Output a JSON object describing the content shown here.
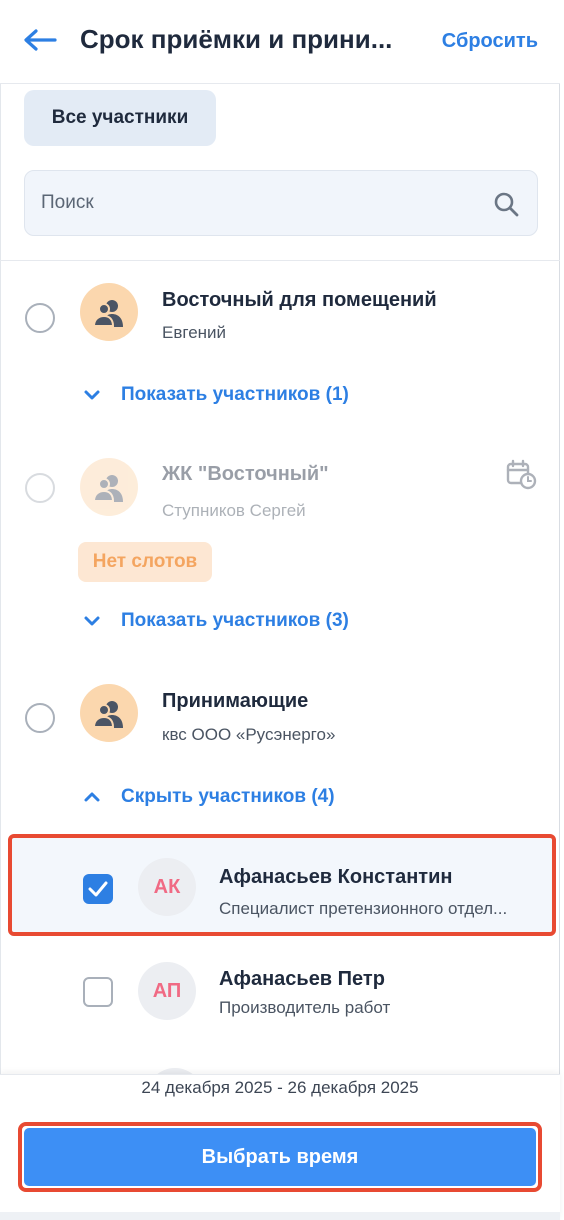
{
  "header": {
    "title": "Срок приёмки и прини...",
    "reset_label": "Сбросить"
  },
  "filter": {
    "chip_label": "Все участники"
  },
  "search": {
    "placeholder": "Поиск"
  },
  "groups": [
    {
      "title": "Восточный для помещений",
      "subtitle": "Евгений",
      "toggle_label": "Показать участников (1)"
    },
    {
      "title": "ЖК \"Восточный\"",
      "subtitle": "Ступников Сергей",
      "badge": "Нет слотов",
      "toggle_label": "Показать участников (3)"
    },
    {
      "title": "Принимающие",
      "subtitle": "квс ООО «Русэнерго»",
      "toggle_label": "Скрыть участников (4)"
    }
  ],
  "members": [
    {
      "initials": "АК",
      "name": "Афанасьев Константин",
      "role": "Специалист претензионного отдел...",
      "checked": true
    },
    {
      "initials": "АП",
      "name": "Афанасьев Петр",
      "role": "Производитель работ",
      "checked": false
    }
  ],
  "footer": {
    "date_range": "24 декабря 2025 - 26 декабря 2025",
    "cta_label": "Выбрать время"
  },
  "colors": {
    "accent": "#2d7fe3",
    "cta": "#3d8ff5",
    "highlight": "#e84a32",
    "group_avatar": "#fbd7ae",
    "member_initials": "#f06a84"
  }
}
